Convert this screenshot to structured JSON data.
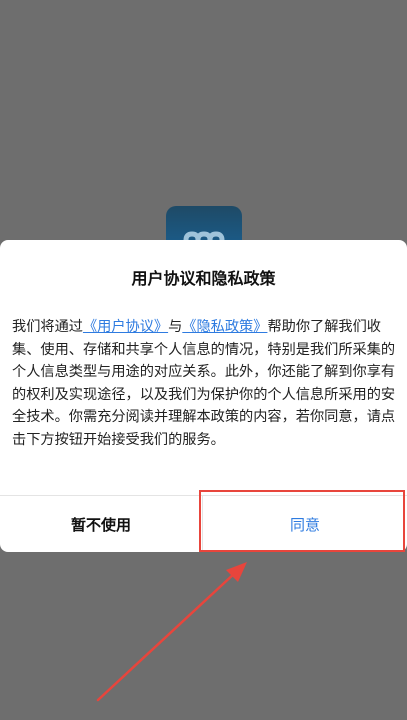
{
  "dialog": {
    "title": "用户协议和隐私政策",
    "body": {
      "prefix": "我们将通过",
      "user_agreement_link": "《用户协议》",
      "conjunction": "与",
      "privacy_policy_link": "《隐私政策》",
      "suffix": "帮助你了解我们收集、使用、存储和共享个人信息的情况，特别是我们所采集的个人信息类型与用途的对应关系。此外，你还能了解到你享有的权利及实现途径，以及我们为保护你的个人信息所采用的安全技术。你需充分阅读并理解本政策的内容，若你同意，请点击下方按钮开始接受我们的服务。"
    },
    "decline_label": "暂不使用",
    "agree_label": "同意"
  },
  "colors": {
    "link": "#2e7be0",
    "highlight": "#e8453c",
    "overlay": "#6e6e6e"
  }
}
